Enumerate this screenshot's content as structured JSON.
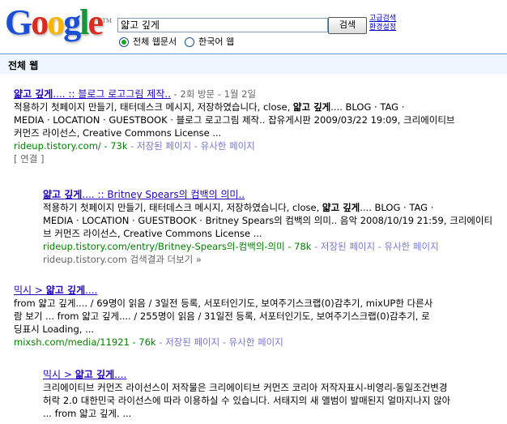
{
  "header": {
    "logo_text": "Google",
    "search_value": "얇고 깊게",
    "search_button": "검색",
    "advanced_search": "고급검색",
    "preferences": "환경설정",
    "radio_all_web": "전체 웹문서",
    "radio_korean": "한국어 웹"
  },
  "bar": {
    "title": "전체 웹"
  },
  "results": [
    {
      "title_bold": "얇고 깊게",
      "title_rest": ".... :: 블로그 로고그림 제작..",
      "meta": " - 2회 방문 - 1월 2일",
      "line1": "적용하기 첫페이지 만들기, 태터데스크 메시지, 저장하였습니다, close, ",
      "line1_bold": "얇고 깊게",
      "line1_tail": ".... BLOG · TAG ·",
      "line2": "MEDIA · LOCATION · GUESTBOOK · 블로그 로고그림 제작.. 잡유게시판 2009/03/22 19:09, 크리에이티브",
      "line3": "커먼즈 라이선스, Creative Commons License ...",
      "url": "rideup.tistory.com/ - 73k",
      "cached": " - 저장된 페이지 - 유사한 페이지",
      "extra": "[ 연결 ]"
    },
    {
      "title_bold": "얇고 깊게",
      "title_rest": ".... :: Britney Spears의 컴백의 의미..",
      "line1": "적용하기 첫페이지 만들기, 태터데스크 메시지, 저장하였습니다, close, ",
      "line1_bold": "얇고 깊게",
      "line1_tail": ".... BLOG · TAG ·",
      "line2": "MEDIA · LOCATION · GUESTBOOK · Britney Spears의 컴백의 의미.. 음악 2008/10/19 21:59, 크리에이티",
      "line3": "브 커먼즈 라이선스, Creative Commons License ...",
      "url": "rideup.tistory.com/entry/Britney-Spears의-컴백의-의미 - 78k",
      "cached": " - 저장된 페이지 - 유사한 페이지",
      "extra": "rideup.tistory.com 검색결과 더보기 »"
    },
    {
      "title_pre": "믹시 > ",
      "title_bold": "얇고 깊게",
      "title_rest": "....",
      "line1": "from 얇고 깊게.... / 69명이 읽음 / 3일전 등록, 서포터인기도, 보여주기스크랩(0)감추기, mixUP한 다른사",
      "line2": "람 보기 ... from 얇고 깊게.... / 255명이 읽음 / 31일전 등록, 서포터인기도, 보여주기스크랩(0)감추기, 로",
      "line3": "딩표시 Loading, ...",
      "url": "mixsh.com/media/11921 - 76k",
      "cached": " - 저장된 페이지 - 유사한 페이지"
    },
    {
      "title_pre": "믹시 > ",
      "title_bold": "얇고 깊게",
      "title_rest": "....",
      "line1": "크리에이티브 커먼즈 라이선스이 저작물은 크리에이티브 커먼즈 코리아 저작자표시-비영리-동일조건변경",
      "line2": "허락 2.0 대한민국 라이선스에 따라 이용하실 수 있습니다. 서태지의 새 앨범이 발매된지 얼마지나지 않아",
      "line3": "... from 얇고 깊게. ..."
    }
  ]
}
